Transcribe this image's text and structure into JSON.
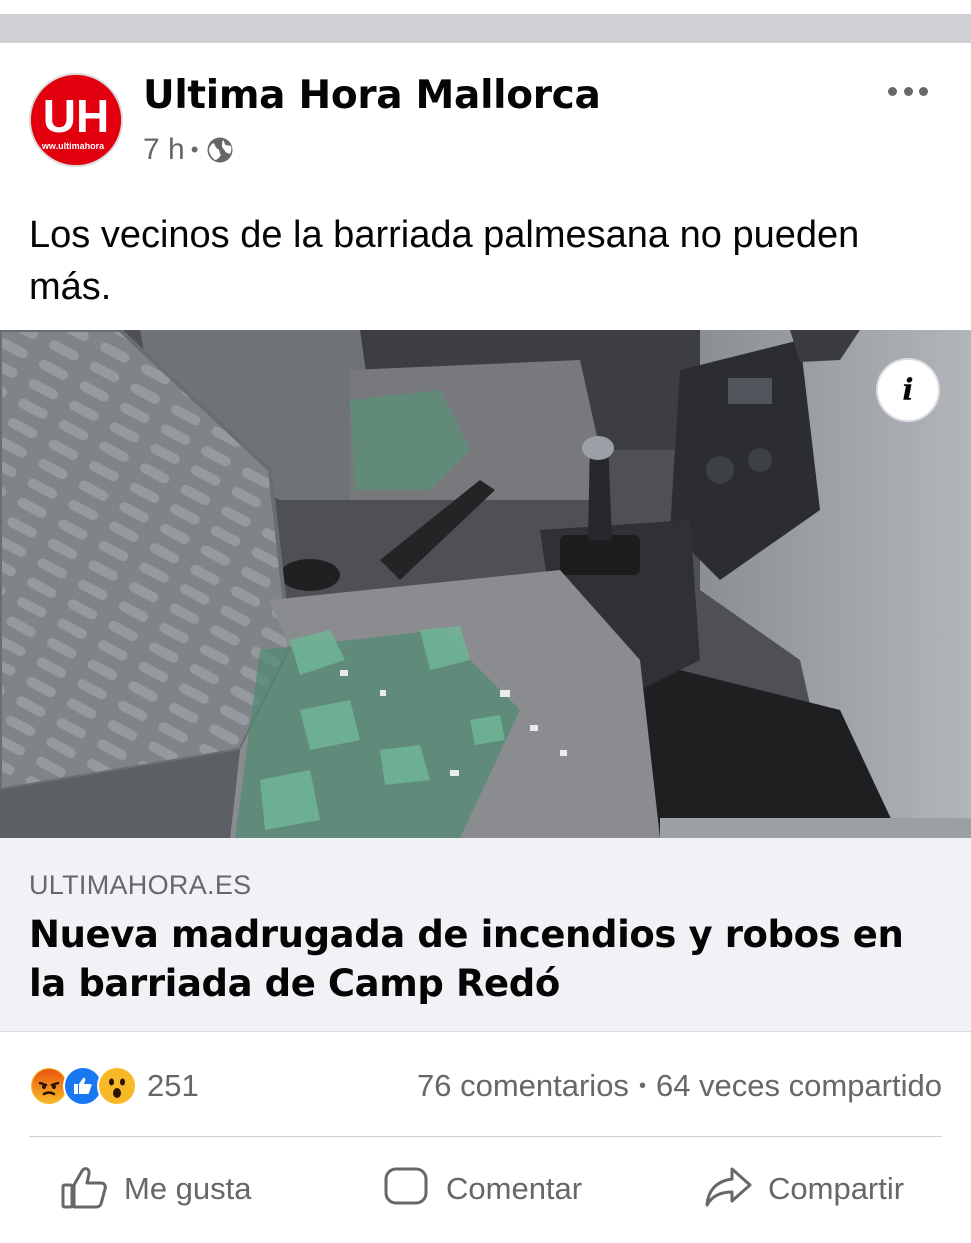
{
  "post": {
    "page_name": "Ultima Hora Mallorca",
    "avatar_text": "UH",
    "avatar_subtext": "ww.ultimahora",
    "time": "7 h",
    "meta_separator": "•",
    "privacy_icon": "globe-icon",
    "more_icon": "more-dots-icon",
    "text": "Los vecinos de la barriada palmesana no pueden más."
  },
  "link_preview": {
    "info_icon": "info-icon",
    "info_label": "i",
    "domain": "ULTIMAHORA.ES",
    "title": "Nueva madrugada de incendios y robos en la barriada de Camp Redó"
  },
  "stats": {
    "reaction_icons": [
      "angry-icon",
      "like-icon",
      "wow-icon"
    ],
    "reaction_count": "251",
    "comments": "76 comentarios",
    "separator": "•",
    "shares": "64 veces compartido"
  },
  "actions": {
    "like": "Me gusta",
    "comment": "Comentar",
    "share": "Compartir"
  },
  "colors": {
    "separator_bar": "#ced0d4",
    "link_box_bg": "#f0f2f5",
    "secondary_text": "#65676b",
    "brand_red": "#e2000f",
    "like_blue": "#1877f2"
  }
}
